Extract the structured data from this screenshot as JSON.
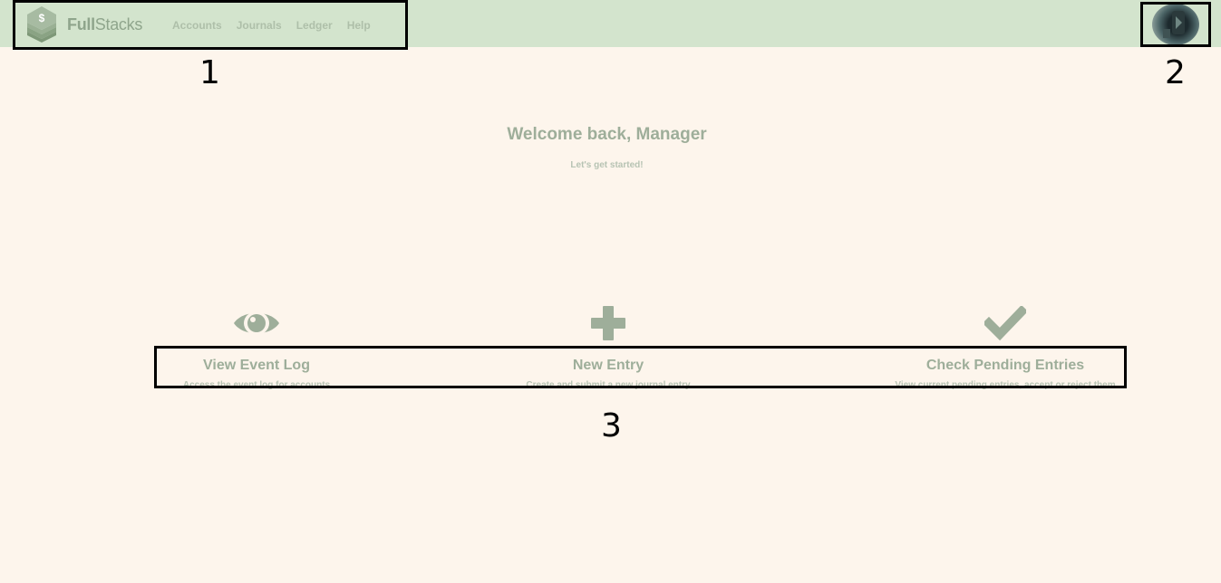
{
  "navbar": {
    "brand_bold": "Full",
    "brand_light": "Stacks",
    "links": [
      "Accounts",
      "Journals",
      "Ledger",
      "Help"
    ],
    "background": "#d3e4cd"
  },
  "main": {
    "welcome": "Welcome back, Manager",
    "subtitle": "Let's get started!",
    "actions": [
      {
        "label": "View Event Log",
        "description": "Access the event log for accounts",
        "icon": "eye-icon"
      },
      {
        "label": "New Entry",
        "description": "Create and submit a new journal entry",
        "icon": "plus-icon"
      },
      {
        "label": "Check Pending Entries",
        "description": "View current pending entries, accept or reject them",
        "icon": "checkmark-icon"
      }
    ]
  },
  "annotations": [
    "1",
    "2",
    "3"
  ],
  "colors": {
    "page_background": "#fdf5ec",
    "accent_green": "#9eae9a",
    "light_green": "#b7c3b3"
  }
}
